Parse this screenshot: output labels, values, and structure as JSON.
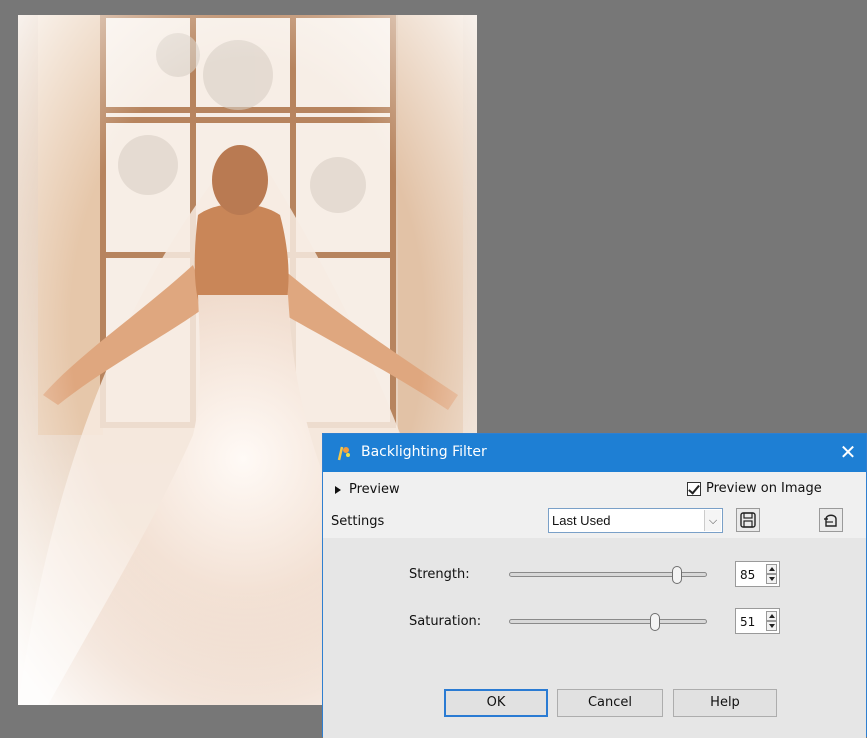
{
  "dialog": {
    "title": "Backlighting Filter",
    "preview_label": "Preview",
    "preview_on_image_label": "Preview on Image",
    "preview_on_image_checked": true,
    "settings_label": "Settings",
    "settings_value": "Last Used",
    "sliders": [
      {
        "label": "Strength:",
        "value": "85",
        "level": 0.85
      },
      {
        "label": "Saturation:",
        "value": "51",
        "level": 0.74
      }
    ],
    "buttons": {
      "ok": "OK",
      "cancel": "Cancel",
      "help": "Help"
    },
    "close_glyph": "✕"
  },
  "icons": [
    "app-logo-icon",
    "close-icon",
    "expand-triangle-icon",
    "checkbox-icon",
    "dropdown-arrow-icon",
    "save-preset-icon",
    "reset-icon",
    "spin-up-icon",
    "spin-down-icon"
  ],
  "colors": {
    "titlebar": "#1e7fd4",
    "workspace": "#777777",
    "ok_border": "#2a7bd3"
  }
}
